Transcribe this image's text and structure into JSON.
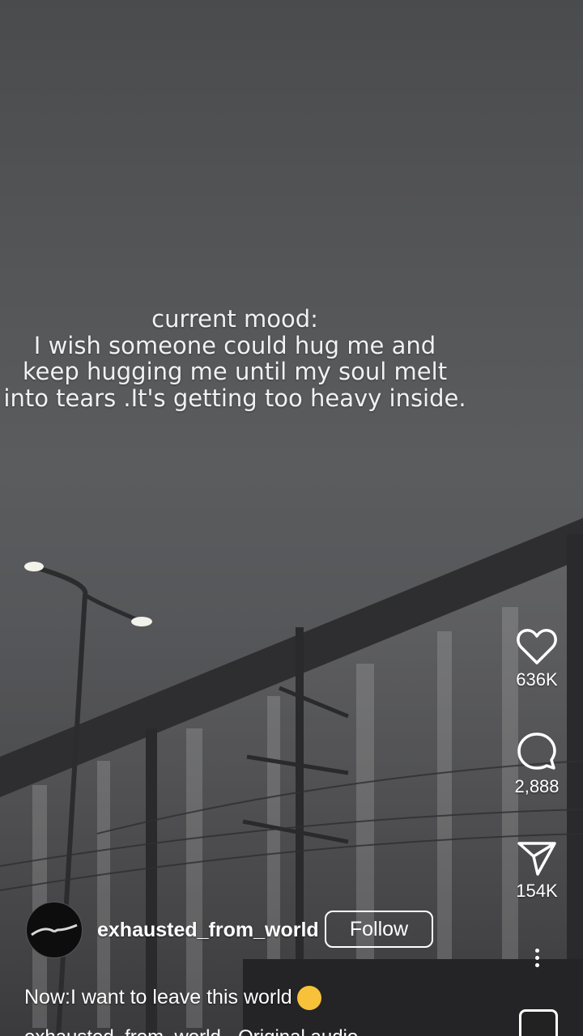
{
  "overlay": {
    "lines": [
      "current mood:",
      "I wish someone could hug me and",
      "keep hugging me until my soul melt",
      "into tears .It's getting too heavy inside."
    ]
  },
  "actions": {
    "likes": "636K",
    "comments": "2,888",
    "shares": "154K"
  },
  "author": {
    "username": "exhausted_from_world",
    "follow_label": "Follow"
  },
  "caption": "Now:I want to leave this world",
  "audio": "exhausted_from_world · Original audio",
  "icons": {
    "like": "heart-icon",
    "comment": "comment-bubble-icon",
    "share": "send-icon",
    "more": "more-vertical-icon",
    "emoji": "crying-face-emoji"
  }
}
